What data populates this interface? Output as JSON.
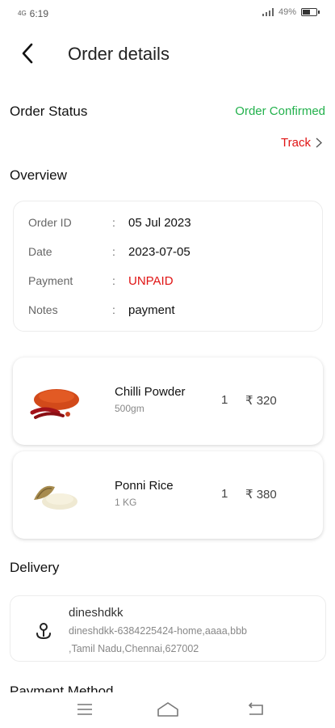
{
  "status_bar": {
    "time": "6:19",
    "signal_label": "4G",
    "battery_percent": "49%",
    "battery_level": 0.49
  },
  "header": {
    "title": "Order details",
    "back_icon": "chevron-left-icon"
  },
  "order_status": {
    "label": "Order Status",
    "value": "Order Confirmed",
    "value_color": "#22b14c",
    "track_label": "Track"
  },
  "overview": {
    "label": "Overview",
    "separator": ":",
    "rows": [
      {
        "key": "Order ID",
        "value": "05 Jul 2023"
      },
      {
        "key": "Date",
        "value": "2023-07-05"
      },
      {
        "key": "Payment",
        "value": "UNPAID"
      },
      {
        "key": "Notes",
        "value": "payment"
      }
    ]
  },
  "items": [
    {
      "name": "Chilli Powder",
      "unit": "500gm",
      "qty": "1",
      "price": "₹ 320"
    },
    {
      "name": "Ponni Rice",
      "unit": "1 KG",
      "qty": "1",
      "price": "₹ 380"
    }
  ],
  "delivery": {
    "label": "Delivery",
    "name": "dineshdkk",
    "address_line1": "dineshdkk-6384225424-home,aaaa,bbb",
    "address_line2": ",Tamil Nadu,Chennai,627002"
  },
  "payment_method": {
    "label": "Payment Method"
  },
  "colors": {
    "accent_red": "#e01414",
    "success_green": "#22b14c"
  }
}
